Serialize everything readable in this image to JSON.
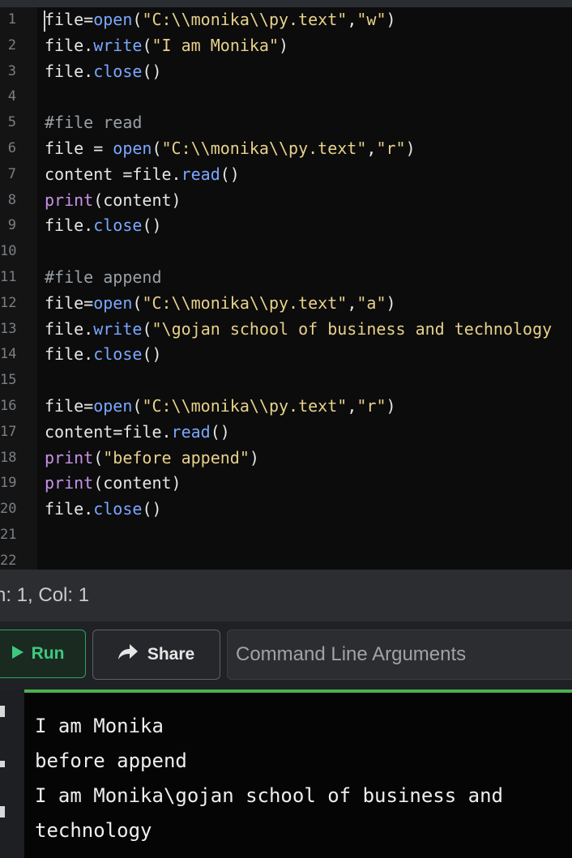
{
  "editor": {
    "line_numbers": [
      "1",
      "2",
      "3",
      "4",
      "5",
      "6",
      "7",
      "8",
      "9",
      "10",
      "11",
      "12",
      "13",
      "14",
      "15",
      "16",
      "17",
      "18",
      "19",
      "20",
      "21",
      "22"
    ],
    "lines": [
      [
        {
          "t": "file=",
          "c": "plain"
        },
        {
          "t": "open",
          "c": "builtin"
        },
        {
          "t": "(",
          "c": "plain"
        },
        {
          "t": "\"C:\\\\monika\\\\py.text\"",
          "c": "str"
        },
        {
          "t": ",",
          "c": "plain"
        },
        {
          "t": "\"w\"",
          "c": "str"
        },
        {
          "t": ")",
          "c": "plain"
        }
      ],
      [
        {
          "t": "file.",
          "c": "plain"
        },
        {
          "t": "write",
          "c": "builtin"
        },
        {
          "t": "(",
          "c": "plain"
        },
        {
          "t": "\"I am Monika\"",
          "c": "str"
        },
        {
          "t": ")",
          "c": "plain"
        }
      ],
      [
        {
          "t": "file.",
          "c": "plain"
        },
        {
          "t": "close",
          "c": "builtin"
        },
        {
          "t": "()",
          "c": "plain"
        }
      ],
      [],
      [
        {
          "t": "#file read",
          "c": "com"
        }
      ],
      [
        {
          "t": "file = ",
          "c": "plain"
        },
        {
          "t": "open",
          "c": "builtin"
        },
        {
          "t": "(",
          "c": "plain"
        },
        {
          "t": "\"C:\\\\monika\\\\py.text\"",
          "c": "str"
        },
        {
          "t": ",",
          "c": "plain"
        },
        {
          "t": "\"r\"",
          "c": "str"
        },
        {
          "t": ")",
          "c": "plain"
        }
      ],
      [
        {
          "t": "content =file.",
          "c": "plain"
        },
        {
          "t": "read",
          "c": "builtin"
        },
        {
          "t": "()",
          "c": "plain"
        }
      ],
      [
        {
          "t": "print",
          "c": "print"
        },
        {
          "t": "(content)",
          "c": "plain"
        }
      ],
      [
        {
          "t": "file.",
          "c": "plain"
        },
        {
          "t": "close",
          "c": "builtin"
        },
        {
          "t": "()",
          "c": "plain"
        }
      ],
      [],
      [
        {
          "t": "#file append",
          "c": "com"
        }
      ],
      [
        {
          "t": "file=",
          "c": "plain"
        },
        {
          "t": "open",
          "c": "builtin"
        },
        {
          "t": "(",
          "c": "plain"
        },
        {
          "t": "\"C:\\\\monika\\\\py.text\"",
          "c": "str"
        },
        {
          "t": ",",
          "c": "plain"
        },
        {
          "t": "\"a\"",
          "c": "str"
        },
        {
          "t": ")",
          "c": "plain"
        }
      ],
      [
        {
          "t": "file.",
          "c": "plain"
        },
        {
          "t": "write",
          "c": "builtin"
        },
        {
          "t": "(",
          "c": "plain"
        },
        {
          "t": "\"\\gojan school of business and technology",
          "c": "str"
        }
      ],
      [
        {
          "t": "file.",
          "c": "plain"
        },
        {
          "t": "close",
          "c": "builtin"
        },
        {
          "t": "()",
          "c": "plain"
        }
      ],
      [],
      [
        {
          "t": "file=",
          "c": "plain"
        },
        {
          "t": "open",
          "c": "builtin"
        },
        {
          "t": "(",
          "c": "plain"
        },
        {
          "t": "\"C:\\\\monika\\\\py.text\"",
          "c": "str"
        },
        {
          "t": ",",
          "c": "plain"
        },
        {
          "t": "\"r\"",
          "c": "str"
        },
        {
          "t": ")",
          "c": "plain"
        }
      ],
      [
        {
          "t": "content=file.",
          "c": "plain"
        },
        {
          "t": "read",
          "c": "builtin"
        },
        {
          "t": "()",
          "c": "plain"
        }
      ],
      [
        {
          "t": "print",
          "c": "print"
        },
        {
          "t": "(",
          "c": "plain"
        },
        {
          "t": "\"before append\"",
          "c": "str"
        },
        {
          "t": ")",
          "c": "plain"
        }
      ],
      [
        {
          "t": "print",
          "c": "print"
        },
        {
          "t": "(content)",
          "c": "plain"
        }
      ],
      [
        {
          "t": "file.",
          "c": "plain"
        },
        {
          "t": "close",
          "c": "builtin"
        },
        {
          "t": "()",
          "c": "plain"
        }
      ],
      [],
      []
    ]
  },
  "status": {
    "text": "n: 1, Col: 1"
  },
  "toolbar": {
    "run_label": "Run",
    "run_icon": "play-icon",
    "share_label": "Share",
    "share_icon": "share-arrow-icon",
    "cmd_placeholder": "Command Line Arguments"
  },
  "output": {
    "lines": [
      "I am Monika",
      "before append",
      "I am Monika\\gojan school of business and",
      "technology"
    ]
  },
  "colors": {
    "accent_green": "#4caf50",
    "run_green": "#3fc97f",
    "string": "#e8d18a",
    "builtin": "#7aa7ff",
    "print_keyword": "#c792ea",
    "comment": "#9aa0a6"
  }
}
